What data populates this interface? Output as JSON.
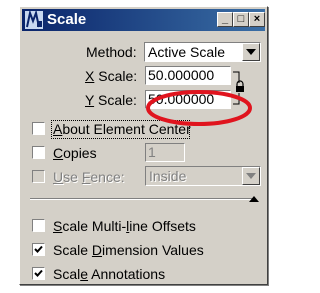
{
  "window": {
    "title": "Scale",
    "minimize_glyph": "_",
    "maximize_glyph": "□",
    "close_glyph": "×"
  },
  "method": {
    "label": "Method:",
    "value": "Active Scale"
  },
  "x_scale": {
    "label_prefix": "X",
    "label_rest": " Scale:",
    "value": "50.000000"
  },
  "y_scale": {
    "label_prefix": "Y",
    "label_rest": " Scale:",
    "value": "50.000000"
  },
  "about_center": {
    "label_prefix": "A",
    "label_rest": "bout Element Center",
    "checked": false
  },
  "copies": {
    "label_prefix": "C",
    "label_rest": "opies",
    "value": "1",
    "checked": false
  },
  "use_fence": {
    "label_prefix": "U",
    "label_mid": "se ",
    "label_u2": "F",
    "label_rest": "ence:",
    "value": "Inside",
    "checked": false,
    "enabled": false
  },
  "multiline_offsets": {
    "label_prefix": "S",
    "label_mid": "cale Multi-",
    "label_u2": "l",
    "label_rest": "ine Offsets",
    "checked": false
  },
  "dimension_values": {
    "label_prefix": "Scale ",
    "label_u": "D",
    "label_rest": "imension Values",
    "checked": true
  },
  "annotations": {
    "label_prefix": "Scal",
    "label_u": "e",
    "label_rest": " Annotations",
    "checked": true
  },
  "icons": {
    "app": "microstation-scale-icon",
    "lock": "lock-icon",
    "collapse": "collapse-up-arrow-icon"
  },
  "colors": {
    "titlebar": "#0a246a",
    "highlight": "#e0141e",
    "dialog": "#d4d0c8"
  }
}
